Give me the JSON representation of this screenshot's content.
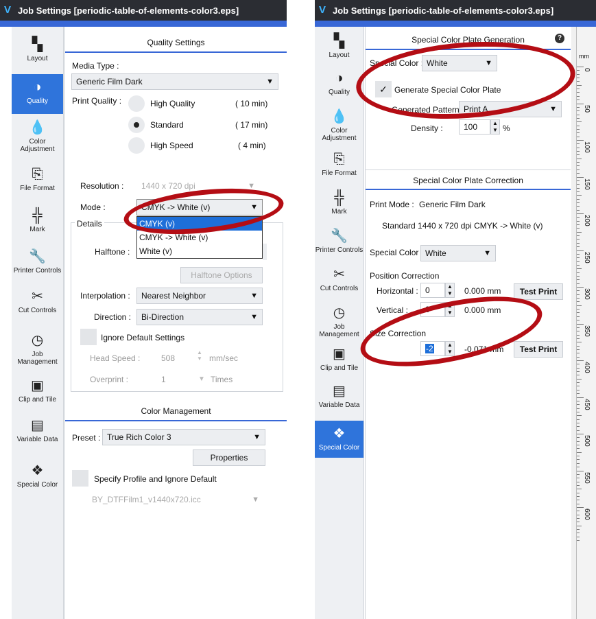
{
  "left": {
    "title": "Job Settings [periodic-table-of-elements-color3.eps]",
    "nav": [
      {
        "label": "Layout",
        "icon": "layout-icon"
      },
      {
        "label": "Quality",
        "icon": "quality-icon"
      },
      {
        "label": "Color Adjustment",
        "icon": "color-adjustment-icon"
      },
      {
        "label": "File Format",
        "icon": "file-format-icon"
      },
      {
        "label": "Mark",
        "icon": "mark-icon"
      },
      {
        "label": "Printer Controls",
        "icon": "wrench-icon"
      },
      {
        "label": "Cut Controls",
        "icon": "scissors-icon"
      },
      {
        "label": "Job Management",
        "icon": "clock-icon"
      },
      {
        "label": "Clip and Tile",
        "icon": "clip-tile-icon"
      },
      {
        "label": "Variable Data",
        "icon": "variable-data-icon"
      },
      {
        "label": "Special Color",
        "icon": "special-color-icon"
      }
    ],
    "quality": {
      "header": "Quality Settings",
      "media_label": "Media Type :",
      "media_value": "Generic Film Dark",
      "print_quality_label": "Print Quality :",
      "options": [
        {
          "label": "High Quality",
          "time": "( 10 min)"
        },
        {
          "label": "Standard",
          "time": "( 17 min)"
        },
        {
          "label": "High Speed",
          "time": "( 4 min)"
        }
      ],
      "resolution_label": "Resolution :",
      "resolution_value": "1440 x 720 dpi",
      "mode_label": "Mode :",
      "mode_value": "CMYK -> White (v)",
      "mode_options": [
        "CMYK (v)",
        "CMYK -> White (v)",
        "White (v)"
      ],
      "details_label": "Details",
      "halftone_label": "Halftone :",
      "halftone_options_button": "Halftone Options",
      "interpolation_label": "Interpolation :",
      "interpolation_value": "Nearest Neighbor",
      "direction_label": "Direction :",
      "direction_value": "Bi-Direction",
      "ignore_label": "Ignore Default Settings",
      "head_speed_label": "Head Speed :",
      "head_speed_value": "508",
      "head_speed_unit": "mm/sec",
      "overprint_label": "Overprint :",
      "overprint_value": "1",
      "overprint_unit": "Times"
    },
    "color_mgmt": {
      "header": "Color Management",
      "preset_label": "Preset :",
      "preset_value": "True Rich Color 3",
      "properties_button": "Properties",
      "specify_label": "Specify Profile and Ignore Default",
      "profile_value": "BY_DTFFilm1_v1440x720.icc"
    }
  },
  "right": {
    "title": "Job Settings [periodic-table-of-elements-color3.eps]",
    "plate_gen": {
      "header": "Special Color Plate Generation",
      "help": "?",
      "special_color_label": "Special Color :",
      "special_color_value": "White",
      "generate_label": "Generate Special Color Plate",
      "pattern_label": "Generated Pattern :",
      "pattern_value": "Print A...",
      "density_label": "Density :",
      "density_value": "100",
      "density_unit": "%"
    },
    "plate_corr": {
      "header": "Special Color Plate Correction",
      "print_mode_label": "Print Mode :",
      "print_mode_value": "Generic Film Dark",
      "mode_desc": "Standard 1440 x 720 dpi CMYK -> White (v)",
      "special_color_label": "Special Color",
      "special_color_value": "White",
      "position_label": "Position Correction",
      "horizontal_label": "Horizontal :",
      "horizontal_value": "0",
      "horizontal_mm": "0.000 mm",
      "vertical_label": "Vertical :",
      "vertical_value": "0",
      "vertical_mm": "0.000 mm",
      "test_print": "Test Print",
      "size_label": "Size Correction",
      "size_value": "-2",
      "size_mm": "-0.071 mm",
      "test_print2": "Test Print"
    },
    "ruler": {
      "unit": "mm",
      "labels": [
        "0",
        "50",
        "100",
        "150",
        "200",
        "250",
        "300",
        "350",
        "400",
        "450",
        "500",
        "550",
        "600"
      ]
    }
  },
  "colors": {
    "accent": "#3867d6",
    "active_nav": "#2f74db",
    "annotation": "#b40d14",
    "titlebar": "#2b2d33"
  }
}
